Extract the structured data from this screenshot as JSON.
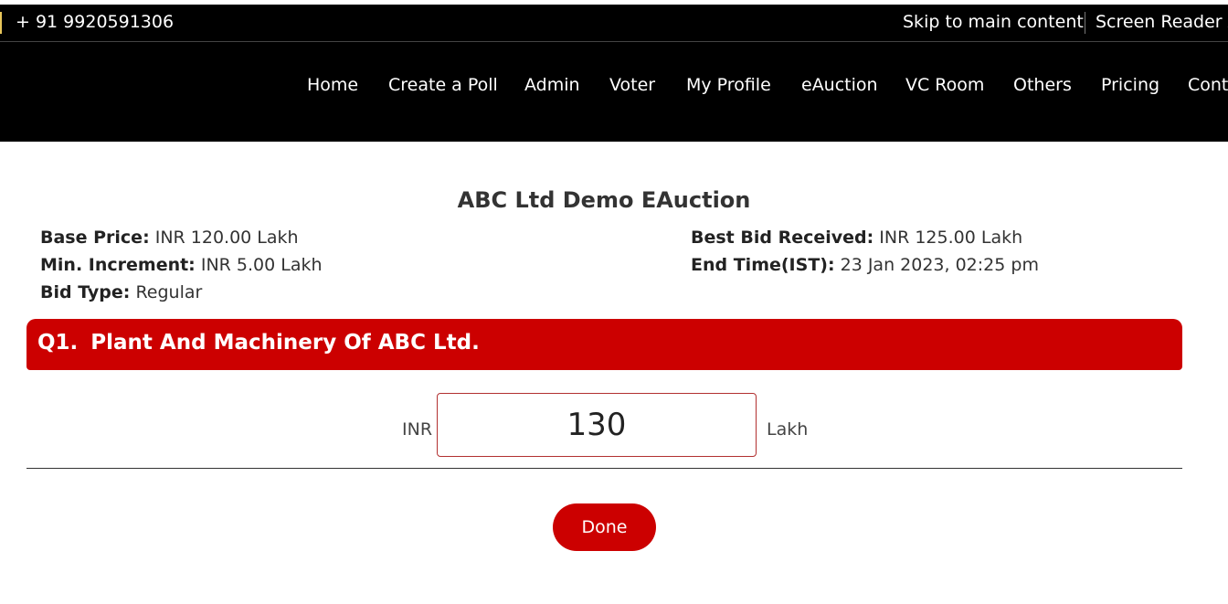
{
  "topbar": {
    "phone": "+ 91 9920591306",
    "skip_link": "Skip to main content",
    "screen_reader": "Screen Reader A"
  },
  "nav": {
    "items": [
      "Home",
      "Create a Poll",
      "Admin",
      "Voter",
      "My Profile",
      "eAuction",
      "VC Room",
      "Others",
      "Pricing",
      "Cont"
    ]
  },
  "auction": {
    "title": "ABC Ltd Demo EAuction",
    "base_price_label": "Base Price:",
    "base_price_value": "INR 120.00 Lakh",
    "min_increment_label": "Min. Increment:",
    "min_increment_value": "INR 5.00 Lakh",
    "bid_type_label": "Bid Type:",
    "bid_type_value": "Regular",
    "best_bid_label": "Best Bid Received:",
    "best_bid_value": "INR 125.00 Lakh",
    "end_time_label": "End Time(IST):",
    "end_time_value": "23 Jan 2023, 02:25 pm"
  },
  "question": {
    "number": "Q1.",
    "text": "Plant And Machinery Of ABC Ltd."
  },
  "bid": {
    "currency": "INR",
    "value": "130",
    "unit": "Lakh"
  },
  "done_label": "Done",
  "colors": {
    "header_bg": "#000000",
    "accent_red": "#cc0000"
  }
}
